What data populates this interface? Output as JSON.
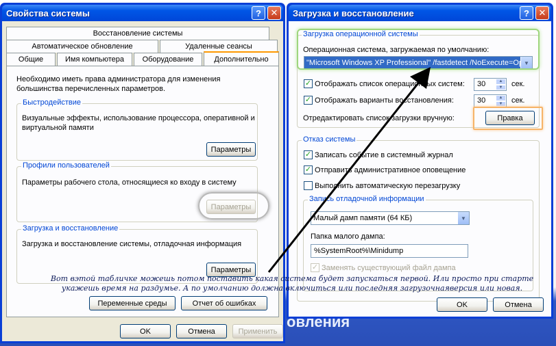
{
  "desktop": {
    "bg_text": "овления"
  },
  "sysprops": {
    "title": "Свойства системы",
    "tabs_row1": [
      "Восстановление системы"
    ],
    "tabs_row2": [
      "Автоматическое обновление",
      "Удаленные сеансы"
    ],
    "tabs_row3": [
      "Общие",
      "Имя компьютера",
      "Оборудование",
      "Дополнительно"
    ],
    "intro": "Необходимо иметь права администратора для изменения большинства перечисленных параметров.",
    "perf": {
      "label": "Быстродействие",
      "text": "Визуальные эффекты, использование процессора, оперативной и виртуальной памяти",
      "button": "Параметры"
    },
    "profiles": {
      "label": "Профили пользователей",
      "text": "Параметры рабочего стола, относящиеся ко входу в систему",
      "button": "Параметры"
    },
    "startup": {
      "label": "Загрузка и восстановление",
      "text": "Загрузка и восстановление системы, отладочная информация",
      "button": "Параметры"
    },
    "env_button": "Переменные среды",
    "errors_button": "Отчет об ошибках",
    "ok": "OK",
    "cancel": "Отмена",
    "apply": "Применить"
  },
  "startup_dlg": {
    "title": "Загрузка и восстановление",
    "os_group": "Загрузка операционной системы",
    "default_os_label": "Операционная система, загружаемая по умолчанию:",
    "default_os_value": "\"Microsoft Windows XP Professional\" /fastdetect /NoExecute=Op",
    "show_list_label": "Отображать список операционных систем:",
    "show_list_value": "30",
    "show_recovery_label": "Отображать варианты восстановления:",
    "show_recovery_value": "30",
    "sec": "сек.",
    "edit_label": "Отредактировать список загрузки вручную:",
    "edit_button": "Правка",
    "failure_group": "Отказ системы",
    "log_event": "Записать событие в системный журнал",
    "send_alert": "Отправить административное оповещение",
    "auto_restart": "Выполнить автоматическую перезагрузку",
    "debug_group": "Запись отладочной информации",
    "dump_type": "Малый дамп памяти (64 КБ)",
    "dump_dir_label": "Папка малого дампа:",
    "dump_dir": "%SystemRoot%\\Minidump",
    "overwrite": "Заменять существующий файл дампа",
    "ok": "OK",
    "cancel": "Отмена"
  },
  "annotation": {
    "line1": "Вот вэтой табличке можешь потом поставить какая система будет запускаться первой. Или просто при старте",
    "line2": "укажешь время на раздумье. А по умолчанию должна включиться или последняя загрузочнаяверсия или новая."
  },
  "colors": {
    "title_blue": "#0054e3",
    "face": "#ece9d8",
    "group_label": "#0046d5",
    "highlight_green": "#9fd67e",
    "highlight_orange": "#f6b468"
  }
}
